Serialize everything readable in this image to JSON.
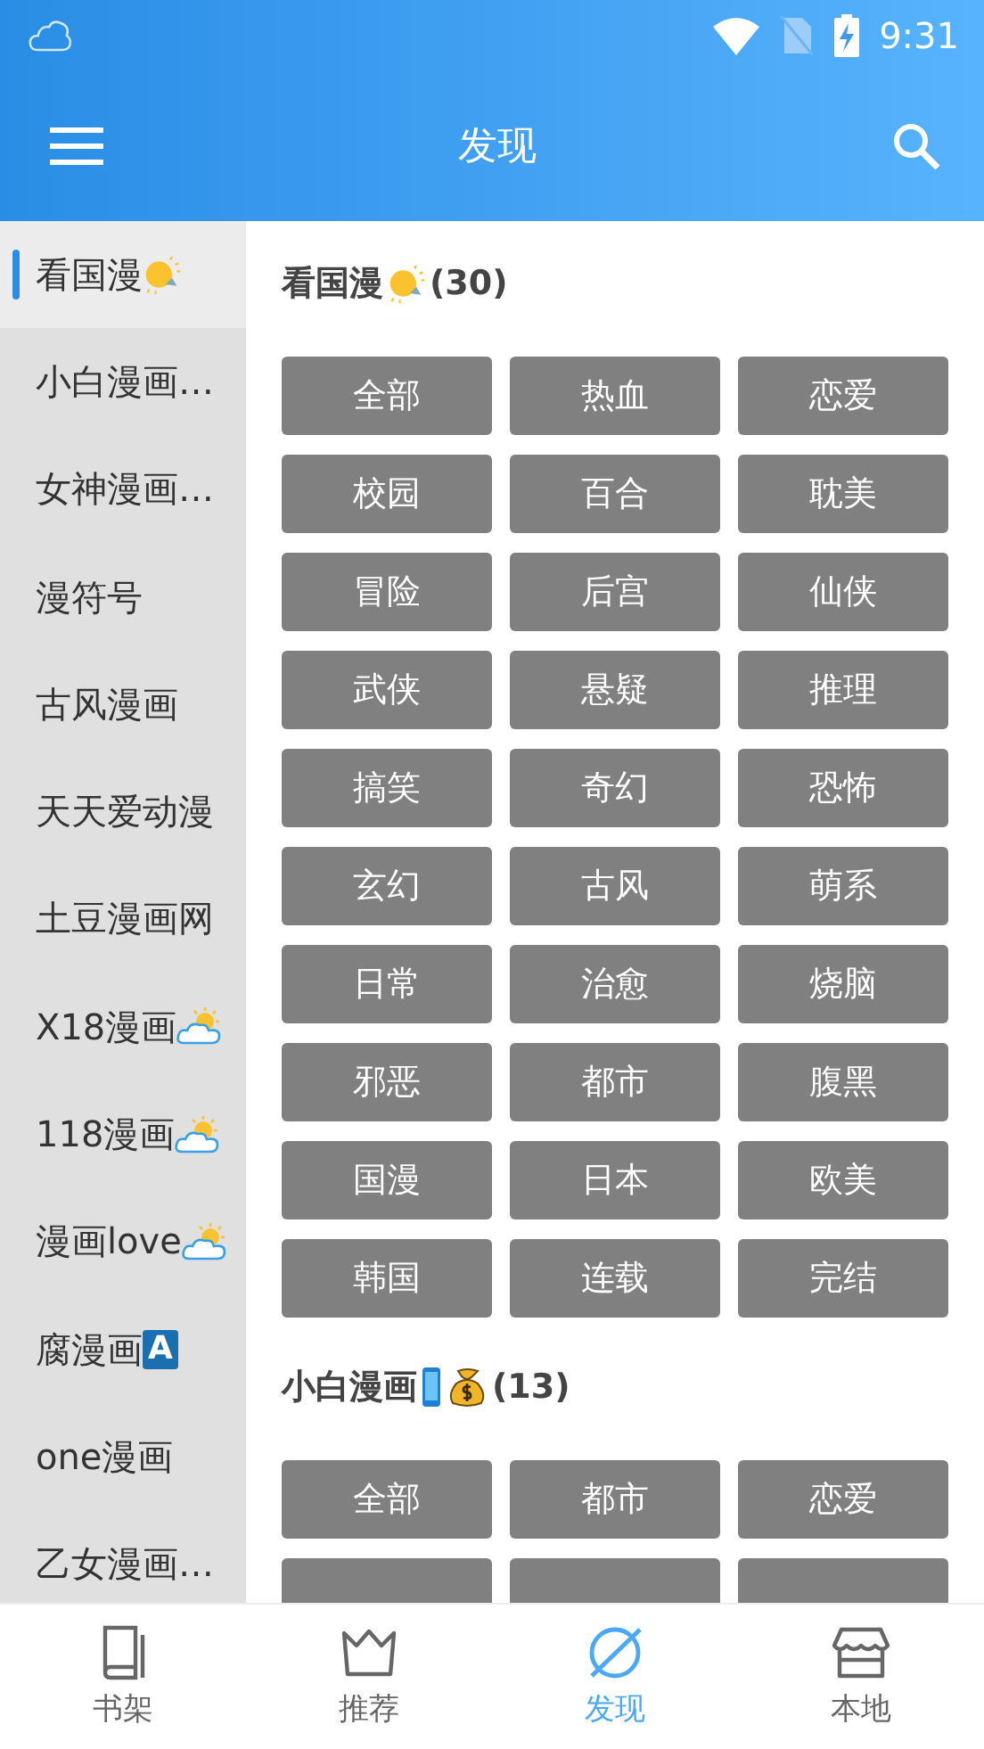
{
  "status_bar": {
    "time": "9:31"
  },
  "app_bar": {
    "title": "发现"
  },
  "sidebar": {
    "items": [
      {
        "label": "看国漫",
        "kind": "bulb",
        "selected": true
      },
      {
        "label": "小白漫画…",
        "kind": "plain",
        "selected": false
      },
      {
        "label": "女神漫画…",
        "kind": "plain",
        "selected": false
      },
      {
        "label": "漫符号",
        "kind": "plain",
        "selected": false
      },
      {
        "label": "古风漫画",
        "kind": "plain",
        "selected": false
      },
      {
        "label": "天天爱动漫",
        "kind": "plain",
        "selected": false
      },
      {
        "label": "土豆漫画网",
        "kind": "plain",
        "selected": false
      },
      {
        "label": "X18漫画",
        "kind": "weather",
        "selected": false
      },
      {
        "label": "118漫画",
        "kind": "weather",
        "selected": false
      },
      {
        "label": "漫画love",
        "kind": "weather",
        "selected": false
      },
      {
        "label": "腐漫画",
        "kind": "badge",
        "badge": "A",
        "selected": false
      },
      {
        "label": "one漫画",
        "kind": "plain",
        "selected": false
      },
      {
        "label": "乙女漫画…",
        "kind": "plain",
        "selected": false
      }
    ]
  },
  "sections": [
    {
      "title": "看国漫",
      "kind": "bulb",
      "count": "(30)",
      "tags": [
        "全部",
        "热血",
        "恋爱",
        "校园",
        "百合",
        "耽美",
        "冒险",
        "后宫",
        "仙侠",
        "武侠",
        "悬疑",
        "推理",
        "搞笑",
        "奇幻",
        "恐怖",
        "玄幻",
        "古风",
        "萌系",
        "日常",
        "治愈",
        "烧脑",
        "邪恶",
        "都市",
        "腹黑",
        "国漫",
        "日本",
        "欧美",
        "韩国",
        "连载",
        "完结"
      ]
    },
    {
      "title": "小白漫画",
      "kind": "phone-money",
      "count": "(13)",
      "tags": [
        "全部",
        "都市",
        "恋爱"
      ]
    }
  ],
  "bottom_nav": [
    {
      "label": "书架",
      "selected": false
    },
    {
      "label": "推荐",
      "selected": false
    },
    {
      "label": "发现",
      "selected": true
    },
    {
      "label": "本地",
      "selected": false
    }
  ]
}
